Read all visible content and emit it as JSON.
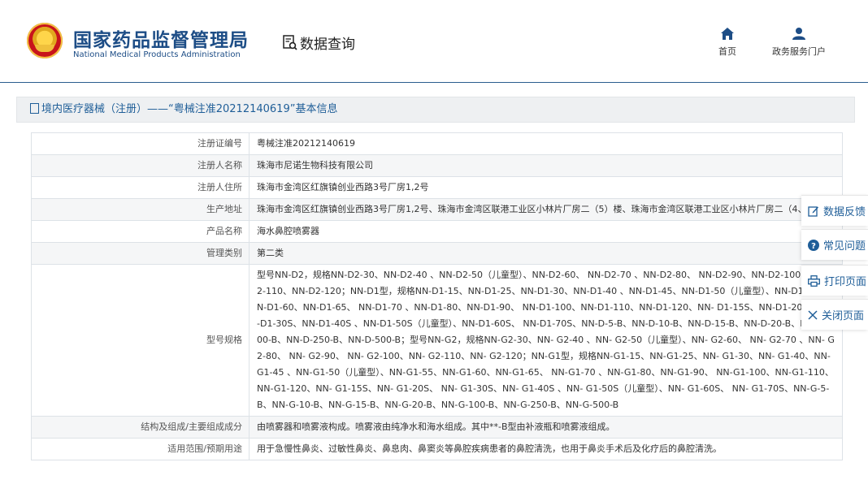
{
  "header": {
    "org_cn": "国家药品监督管理局",
    "org_en": "National Medical Products Administration",
    "section": "数据查询",
    "nav": [
      {
        "label": "首页",
        "icon": "home-icon"
      },
      {
        "label": "政务服务门户",
        "icon": "user-icon"
      }
    ]
  },
  "page_title": "境内医疗器械（注册）——“粤械注准20212140619”基本信息",
  "rows": [
    {
      "label": "注册证编号",
      "value": "粤械注准20212140619"
    },
    {
      "label": "注册人名称",
      "value": "珠海市尼诺生物科技有限公司"
    },
    {
      "label": "注册人住所",
      "value": "珠海市金湾区红旗镇创业西路3号厂房1,2号"
    },
    {
      "label": "生产地址",
      "value": "珠海市金湾区红旗镇创业西路3号厂房1,2号、珠海市金湾区联港工业区小林片厂房二（5）楼、珠海市金湾区联港工业区小林片厂房二（4、5）楼"
    },
    {
      "label": "产品名称",
      "value": "海水鼻腔喷雾器"
    },
    {
      "label": "管理类别",
      "value": "第二类"
    },
    {
      "label": "型号规格",
      "value": "型号NN-D2，规格NN-D2-30、NN-D2-40 、NN-D2-50（儿童型）、NN-D2-60、 NN-D2-70 、NN-D2-80、 NN-D2-90、NN-D2-100、NN-D2-110、NN-D2-120；NN-D1型，规格NN-D1-15、NN-D1-25、NN-D1-30、NN-D1-40 、NN-D1-45、NN-D1-50（儿童型）、NN-D1-55、NN-D1-60、NN-D1-65、 NN-D1-70 、NN-D1-80、NN-D1-90、 NN-D1-100、NN-D1-110、NN-D1-120、NN- D1-15S、NN-D1-20S、 NN-D1-30S、NN-D1-40S 、NN-D1-50S（儿童型）、NN-D1-60S、 NN-D1-70S、NN-D-5-B、NN-D-10-B、NN-D-15-B、NN-D-20-B、NN-D-100-B、NN-D-250-B、NN-D-500-B；型号NN-G2，规格NN-G2-30、NN- G2-40 、NN- G2-50（儿童型）、NN- G2-60、 NN- G2-70 、NN- G2-80、 NN- G2-90、 NN- G2-100、NN- G2-110、NN- G2-120；NN-G1型，规格NN-G1-15、NN-G1-25、NN- G1-30、NN- G1-40、NN-G1-45 、NN-G1-50（儿童型）、NN-G1-55、NN-G1-60、NN-G1-65、 NN-G1-70 、NN-G1-80、NN-G1-90、 NN-G1-100、NN-G1-110、NN-G1-120、NN- G1-15S、NN- G1-20S、 NN- G1-30S、NN- G1-40S 、NN- G1-50S（儿童型）、NN- G1-60S、 NN- G1-70S、NN-G-5-B、NN-G-10-B、NN-G-15-B、NN-G-20-B、NN-G-100-B、NN-G-250-B、NN-G-500-B"
    },
    {
      "label": "结构及组成/主要组成成分",
      "value": "由喷雾器和喷雾液构成。喷雾液由纯净水和海水组成。其中**-B型由补液瓶和喷雾液组成。"
    },
    {
      "label": "适用范围/预期用途",
      "value": "用于急慢性鼻炎、过敏性鼻炎、鼻息肉、鼻窦炎等鼻腔疾病患者的鼻腔清洗，也用于鼻炎手术后及化疗后的鼻腔清洗。"
    }
  ],
  "floaters": [
    {
      "label": "数据反馈",
      "icon": "edit-icon"
    },
    {
      "label": "常见问题",
      "icon": "question-icon"
    },
    {
      "label": "打印页面",
      "icon": "print-icon"
    },
    {
      "label": "关闭页面",
      "icon": "close-icon"
    }
  ],
  "colors": {
    "brand": "#1d4d86",
    "link": "#1f5e98",
    "row_alt": "#f5f6f7",
    "title_bg": "#eef0f2"
  }
}
